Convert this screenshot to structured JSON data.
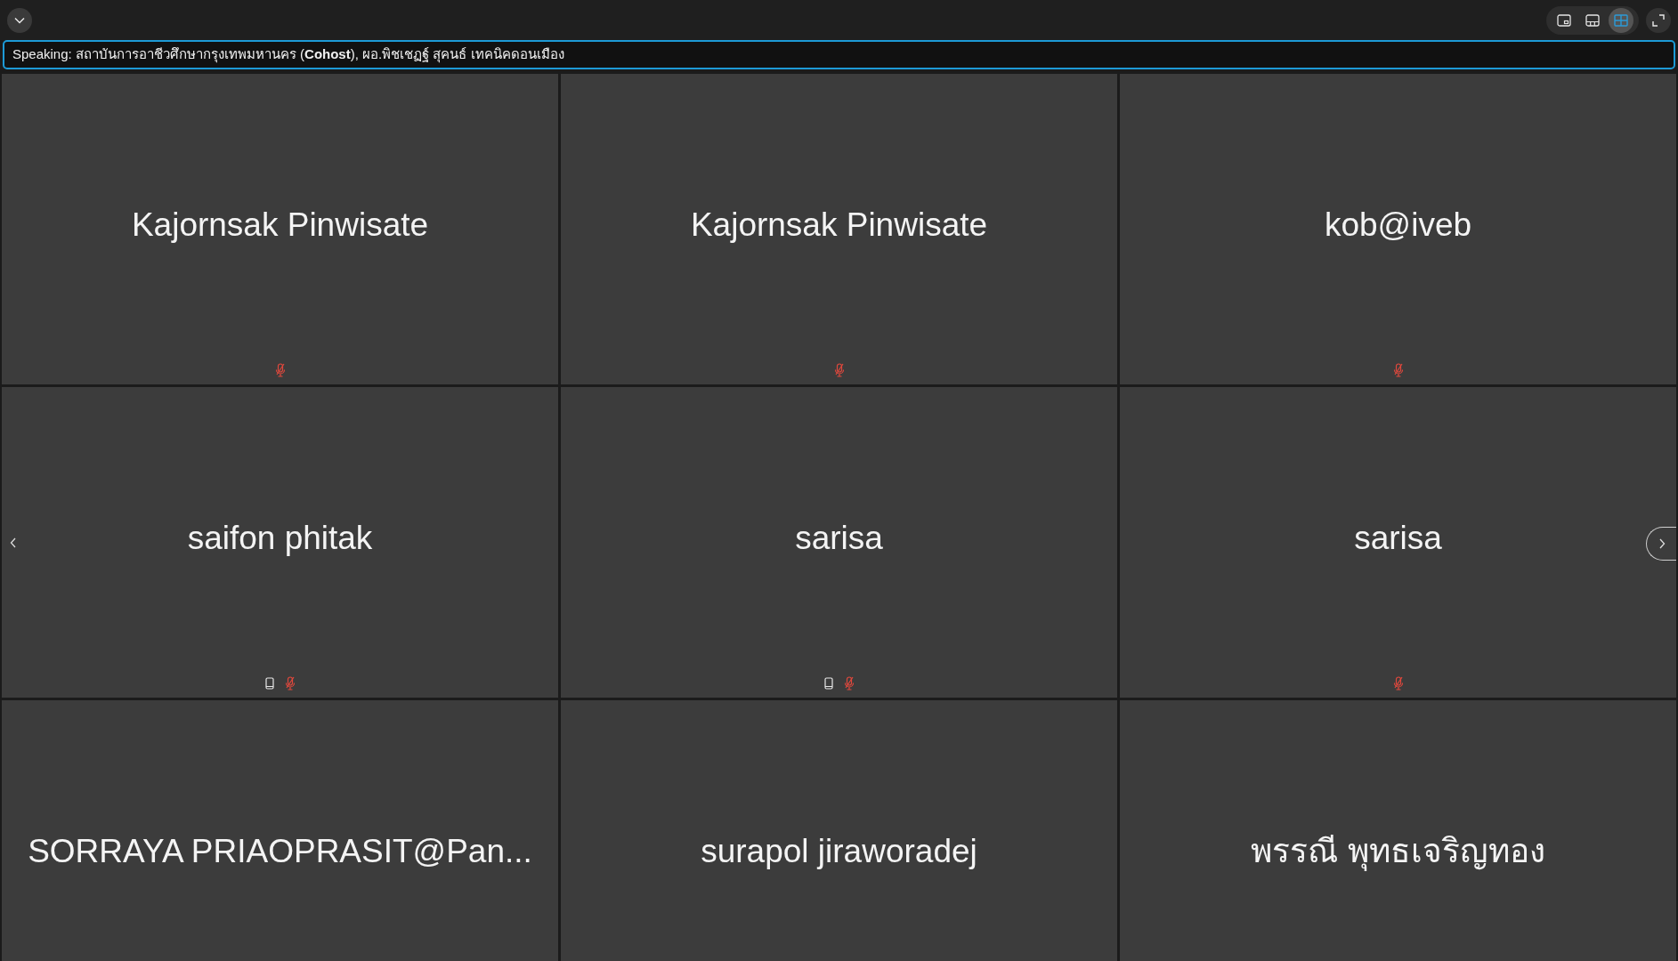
{
  "view_buttons": [
    {
      "kind": "pip",
      "selected": false
    },
    {
      "kind": "filmstrip",
      "selected": false
    },
    {
      "kind": "grid",
      "selected": true
    }
  ],
  "speaking": "Speaking: สถาบันการอาชีวศึกษากรุงเทพมหานคร (**Cohost**), ผอ.พิชเชฏฐ์ สุคนธ์ เทคนิคดอนเมือง",
  "tiles": [
    {
      "name": "Kajornsak Pinwisate",
      "phone": false,
      "muted": true
    },
    {
      "name": "Kajornsak Pinwisate",
      "phone": false,
      "muted": true
    },
    {
      "name": "kob@iveb",
      "phone": false,
      "muted": true
    },
    {
      "name": "saifon phitak",
      "phone": true,
      "muted": true
    },
    {
      "name": "sarisa",
      "phone": true,
      "muted": true
    },
    {
      "name": "sarisa",
      "phone": false,
      "muted": true
    },
    {
      "name": "SORRAYA PRIAOPRASIT@Pan..."
    },
    {
      "name": "surapol jiraworadej"
    },
    {
      "name": "พรรณี พุทธเจริญทอง"
    }
  ]
}
